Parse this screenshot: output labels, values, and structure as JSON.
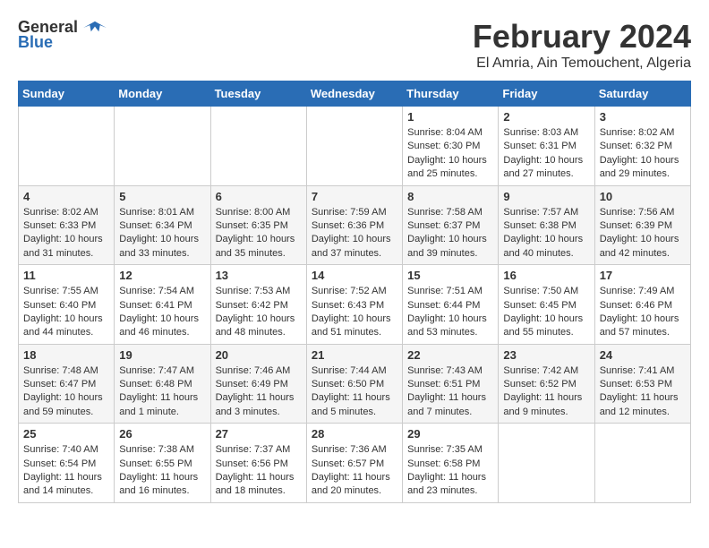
{
  "logo": {
    "general": "General",
    "blue": "Blue"
  },
  "header": {
    "month_year": "February 2024",
    "location": "El Amria, Ain Temouchent, Algeria"
  },
  "days_of_week": [
    "Sunday",
    "Monday",
    "Tuesday",
    "Wednesday",
    "Thursday",
    "Friday",
    "Saturday"
  ],
  "weeks": [
    {
      "days": [
        {
          "num": "",
          "info": ""
        },
        {
          "num": "",
          "info": ""
        },
        {
          "num": "",
          "info": ""
        },
        {
          "num": "",
          "info": ""
        },
        {
          "num": "1",
          "info": "Sunrise: 8:04 AM\nSunset: 6:30 PM\nDaylight: 10 hours and 25 minutes."
        },
        {
          "num": "2",
          "info": "Sunrise: 8:03 AM\nSunset: 6:31 PM\nDaylight: 10 hours and 27 minutes."
        },
        {
          "num": "3",
          "info": "Sunrise: 8:02 AM\nSunset: 6:32 PM\nDaylight: 10 hours and 29 minutes."
        }
      ]
    },
    {
      "days": [
        {
          "num": "4",
          "info": "Sunrise: 8:02 AM\nSunset: 6:33 PM\nDaylight: 10 hours and 31 minutes."
        },
        {
          "num": "5",
          "info": "Sunrise: 8:01 AM\nSunset: 6:34 PM\nDaylight: 10 hours and 33 minutes."
        },
        {
          "num": "6",
          "info": "Sunrise: 8:00 AM\nSunset: 6:35 PM\nDaylight: 10 hours and 35 minutes."
        },
        {
          "num": "7",
          "info": "Sunrise: 7:59 AM\nSunset: 6:36 PM\nDaylight: 10 hours and 37 minutes."
        },
        {
          "num": "8",
          "info": "Sunrise: 7:58 AM\nSunset: 6:37 PM\nDaylight: 10 hours and 39 minutes."
        },
        {
          "num": "9",
          "info": "Sunrise: 7:57 AM\nSunset: 6:38 PM\nDaylight: 10 hours and 40 minutes."
        },
        {
          "num": "10",
          "info": "Sunrise: 7:56 AM\nSunset: 6:39 PM\nDaylight: 10 hours and 42 minutes."
        }
      ]
    },
    {
      "days": [
        {
          "num": "11",
          "info": "Sunrise: 7:55 AM\nSunset: 6:40 PM\nDaylight: 10 hours and 44 minutes."
        },
        {
          "num": "12",
          "info": "Sunrise: 7:54 AM\nSunset: 6:41 PM\nDaylight: 10 hours and 46 minutes."
        },
        {
          "num": "13",
          "info": "Sunrise: 7:53 AM\nSunset: 6:42 PM\nDaylight: 10 hours and 48 minutes."
        },
        {
          "num": "14",
          "info": "Sunrise: 7:52 AM\nSunset: 6:43 PM\nDaylight: 10 hours and 51 minutes."
        },
        {
          "num": "15",
          "info": "Sunrise: 7:51 AM\nSunset: 6:44 PM\nDaylight: 10 hours and 53 minutes."
        },
        {
          "num": "16",
          "info": "Sunrise: 7:50 AM\nSunset: 6:45 PM\nDaylight: 10 hours and 55 minutes."
        },
        {
          "num": "17",
          "info": "Sunrise: 7:49 AM\nSunset: 6:46 PM\nDaylight: 10 hours and 57 minutes."
        }
      ]
    },
    {
      "days": [
        {
          "num": "18",
          "info": "Sunrise: 7:48 AM\nSunset: 6:47 PM\nDaylight: 10 hours and 59 minutes."
        },
        {
          "num": "19",
          "info": "Sunrise: 7:47 AM\nSunset: 6:48 PM\nDaylight: 11 hours and 1 minute."
        },
        {
          "num": "20",
          "info": "Sunrise: 7:46 AM\nSunset: 6:49 PM\nDaylight: 11 hours and 3 minutes."
        },
        {
          "num": "21",
          "info": "Sunrise: 7:44 AM\nSunset: 6:50 PM\nDaylight: 11 hours and 5 minutes."
        },
        {
          "num": "22",
          "info": "Sunrise: 7:43 AM\nSunset: 6:51 PM\nDaylight: 11 hours and 7 minutes."
        },
        {
          "num": "23",
          "info": "Sunrise: 7:42 AM\nSunset: 6:52 PM\nDaylight: 11 hours and 9 minutes."
        },
        {
          "num": "24",
          "info": "Sunrise: 7:41 AM\nSunset: 6:53 PM\nDaylight: 11 hours and 12 minutes."
        }
      ]
    },
    {
      "days": [
        {
          "num": "25",
          "info": "Sunrise: 7:40 AM\nSunset: 6:54 PM\nDaylight: 11 hours and 14 minutes."
        },
        {
          "num": "26",
          "info": "Sunrise: 7:38 AM\nSunset: 6:55 PM\nDaylight: 11 hours and 16 minutes."
        },
        {
          "num": "27",
          "info": "Sunrise: 7:37 AM\nSunset: 6:56 PM\nDaylight: 11 hours and 18 minutes."
        },
        {
          "num": "28",
          "info": "Sunrise: 7:36 AM\nSunset: 6:57 PM\nDaylight: 11 hours and 20 minutes."
        },
        {
          "num": "29",
          "info": "Sunrise: 7:35 AM\nSunset: 6:58 PM\nDaylight: 11 hours and 23 minutes."
        },
        {
          "num": "",
          "info": ""
        },
        {
          "num": "",
          "info": ""
        }
      ]
    }
  ]
}
